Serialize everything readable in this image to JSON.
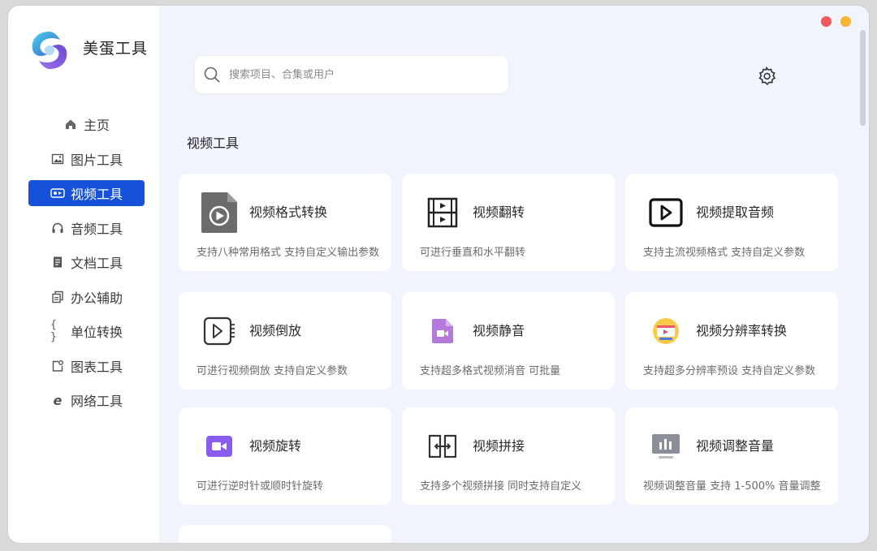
{
  "app": {
    "title": "美蛋工具"
  },
  "sidebar": {
    "items": [
      {
        "label": "主页",
        "icon": "home-icon",
        "active": false
      },
      {
        "label": "图片工具",
        "icon": "image-icon",
        "active": false
      },
      {
        "label": "视频工具",
        "icon": "video-icon",
        "active": true
      },
      {
        "label": "音频工具",
        "icon": "headphones-icon",
        "active": false
      },
      {
        "label": "文档工具",
        "icon": "document-icon",
        "active": false
      },
      {
        "label": "办公辅助",
        "icon": "copy-icon",
        "active": false
      },
      {
        "label": "单位转换",
        "icon": "braces-icon",
        "active": false
      },
      {
        "label": "图表工具",
        "icon": "chart-icon",
        "active": false
      },
      {
        "label": "网络工具",
        "icon": "browser-icon",
        "active": false
      }
    ]
  },
  "search": {
    "placeholder": "搜索项目、合集或用户"
  },
  "section": {
    "title": "视频工具"
  },
  "tools": [
    {
      "title": "视频格式转换",
      "desc": "支持八种常用格式 支持自定义输出参数",
      "icon": "video-file-icon"
    },
    {
      "title": "视频翻转",
      "desc": "可进行垂直和水平翻转",
      "icon": "flip-icon"
    },
    {
      "title": "视频提取音频",
      "desc": "支持主流视频格式 支持自定义参数",
      "icon": "play-box-icon"
    },
    {
      "title": "视频倒放",
      "desc": "可进行视频倒放 支持自定义参数",
      "icon": "reverse-play-icon"
    },
    {
      "title": "视频静音",
      "desc": "支持超多格式视频消音 可批量",
      "icon": "mute-video-icon"
    },
    {
      "title": "视频分辨率转换",
      "desc": "支持超多分辨率预设 支持自定义参数",
      "icon": "resolution-icon"
    },
    {
      "title": "视频旋转",
      "desc": "可进行逆时针或顺时针旋转",
      "icon": "camera-icon"
    },
    {
      "title": "视频拼接",
      "desc": "支持多个视频拼接 同时支持自定义",
      "icon": "merge-icon"
    },
    {
      "title": "视频调整音量",
      "desc": "视频调整音量 支持 1-500% 音量调整",
      "icon": "volume-bars-icon"
    }
  ],
  "colors": {
    "accent": "#1652d9",
    "window_close": "#f05a5a",
    "window_minimize": "#f5b52e",
    "background": "#f1f3fd"
  }
}
